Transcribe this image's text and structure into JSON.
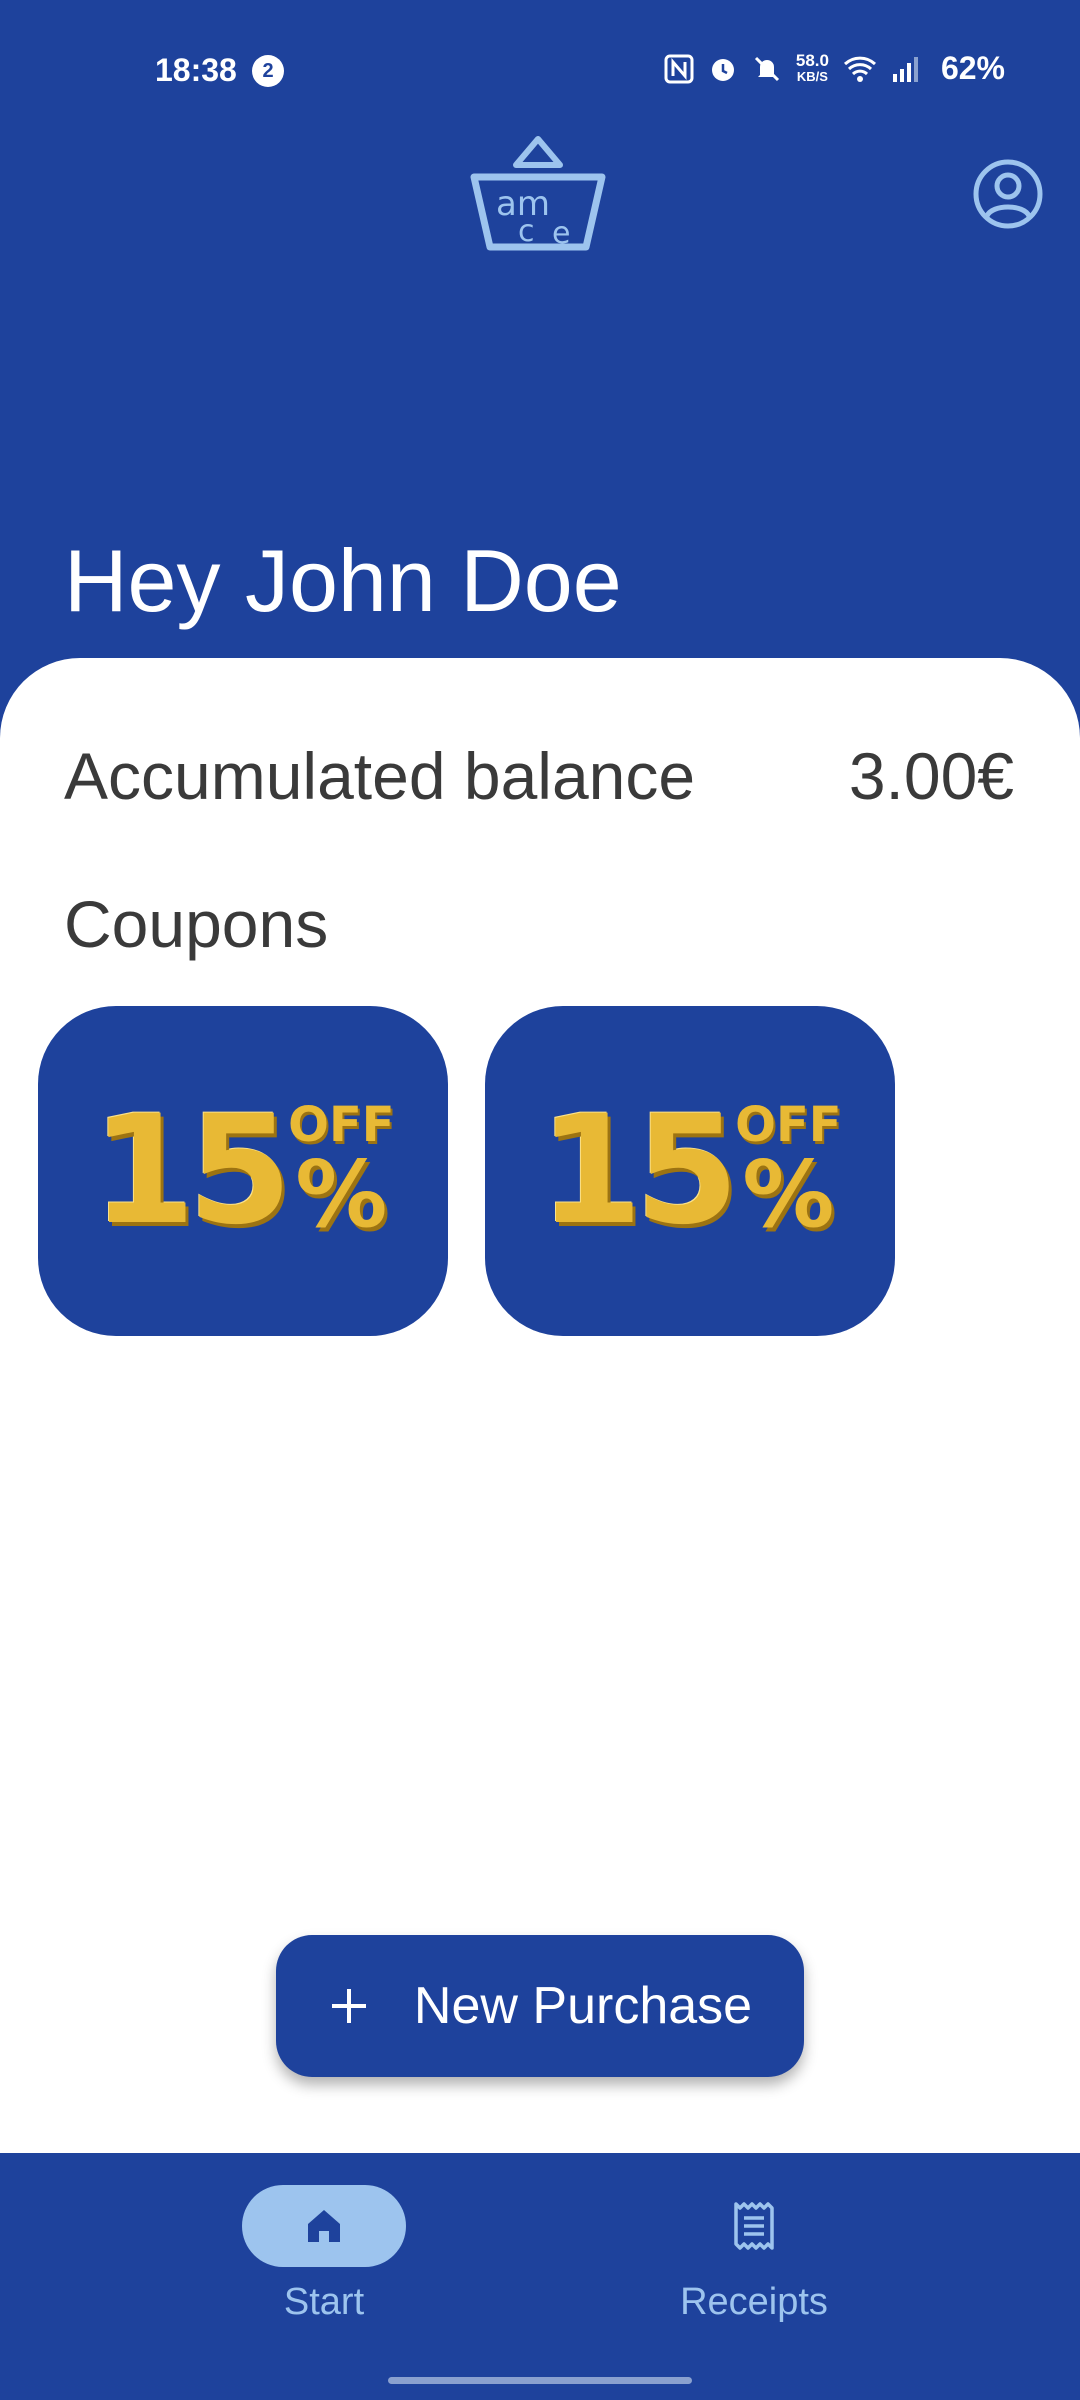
{
  "status_bar": {
    "time": "18:38",
    "notification_count": "2",
    "net_speed_value": "58.0",
    "net_speed_unit": "KB/S",
    "battery": "62%"
  },
  "header": {
    "logo_icon": "amce-basket-logo",
    "profile_icon": "account-circle-icon"
  },
  "greeting": "Hey John Doe",
  "balance": {
    "label": "Accumulated balance",
    "value": "3.00€"
  },
  "coupons": {
    "title": "Coupons",
    "items": [
      {
        "number": "15",
        "off": "OFF",
        "percent": "%"
      },
      {
        "number": "15",
        "off": "OFF",
        "percent": "%"
      }
    ]
  },
  "fab": {
    "icon": "plus-icon",
    "label": "New Purchase"
  },
  "bottom_nav": {
    "items": [
      {
        "label": "Start",
        "icon": "home-icon",
        "active": true
      },
      {
        "label": "Receipts",
        "icon": "receipt-icon",
        "active": false
      }
    ]
  },
  "colors": {
    "primary": "#1e429c",
    "accent_light": "#9dc4ee",
    "text_dark": "#3a3a3a",
    "coupon_gold": "#e8b935"
  }
}
